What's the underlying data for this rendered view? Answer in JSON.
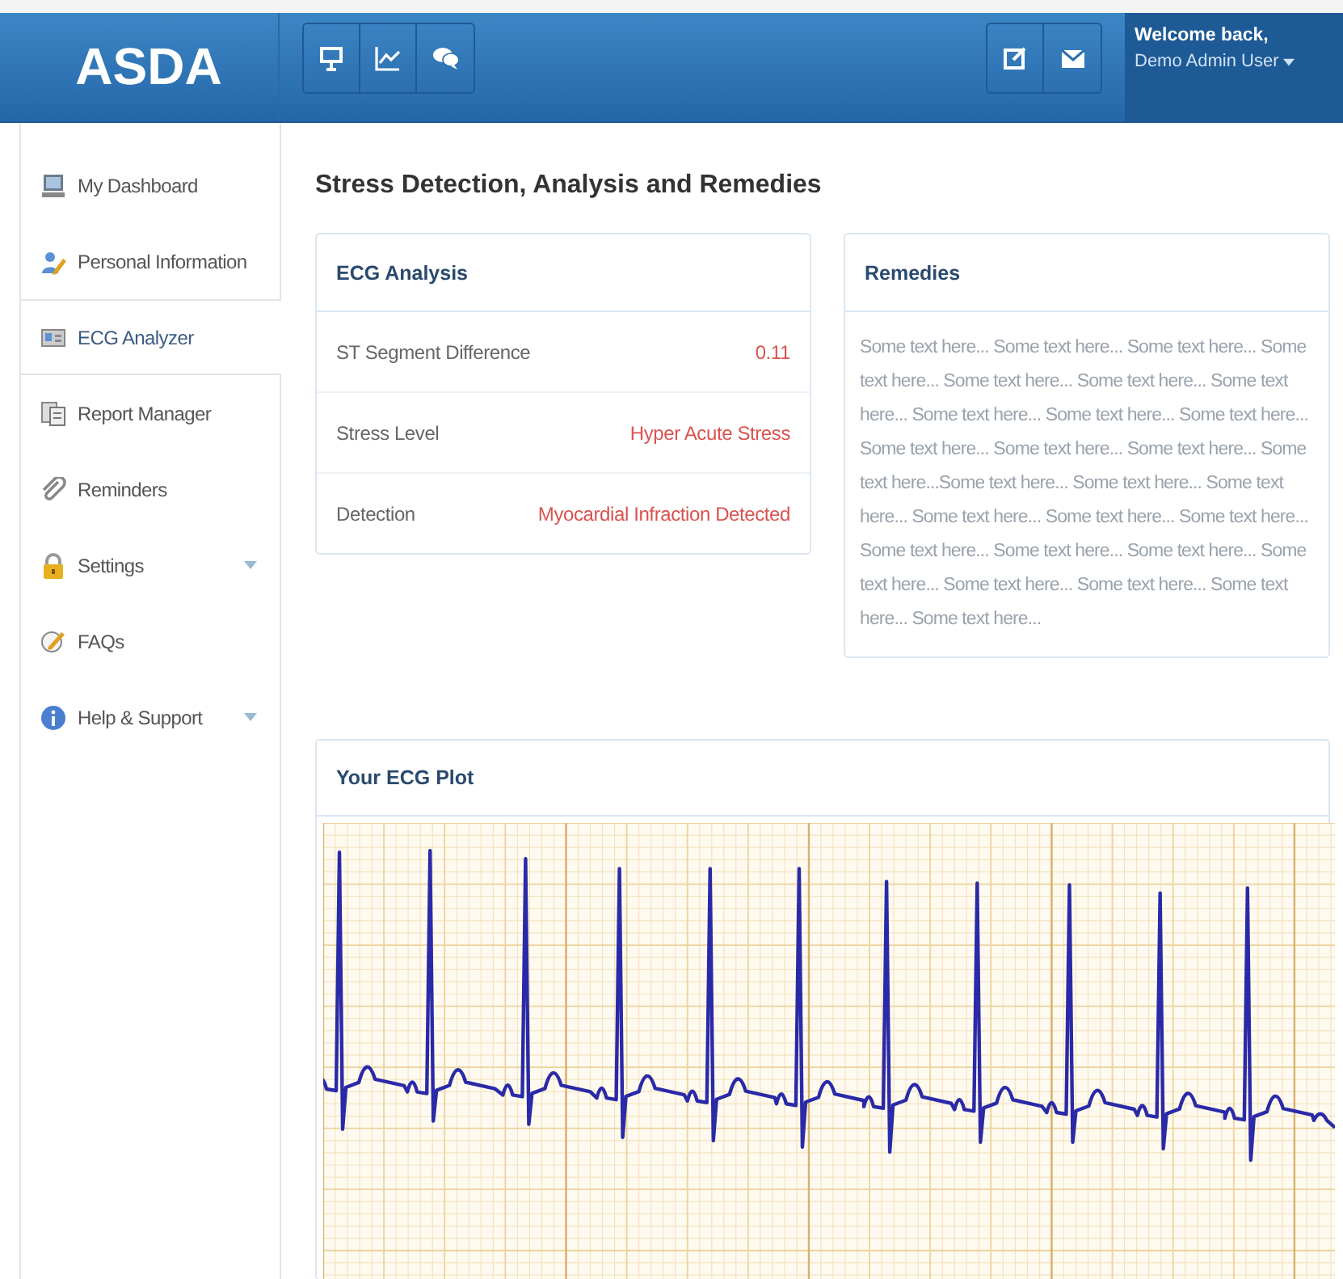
{
  "header": {
    "logo": "ASDA",
    "user": {
      "greeting": "Welcome back,",
      "name": "Demo Admin User"
    }
  },
  "sidebar": {
    "items": [
      {
        "label": "My Dashboard",
        "selected": false,
        "has_submenu": false
      },
      {
        "label": "Personal Information",
        "selected": false,
        "has_submenu": false
      },
      {
        "label": "ECG Analyzer",
        "selected": true,
        "has_submenu": false
      },
      {
        "label": "Report Manager",
        "selected": false,
        "has_submenu": false
      },
      {
        "label": "Reminders",
        "selected": false,
        "has_submenu": false
      },
      {
        "label": "Settings",
        "selected": false,
        "has_submenu": true
      },
      {
        "label": "FAQs",
        "selected": false,
        "has_submenu": false
      },
      {
        "label": "Help & Support",
        "selected": false,
        "has_submenu": true
      }
    ]
  },
  "page_title": "Stress Detection, Analysis and Remedies",
  "ecg_analysis": {
    "title": "ECG Analysis",
    "rows": [
      {
        "label": "ST Segment Difference",
        "value": "0.11"
      },
      {
        "label": "Stress Level",
        "value": "Hyper Acute Stress"
      },
      {
        "label": "Detection",
        "value": "Myocardial Infraction Detected"
      }
    ]
  },
  "remedies": {
    "title": "Remedies",
    "text": "Some text here... Some text here... Some text here... Some text here... Some text here... Some text here... Some text here... Some text here... Some text here... Some text here... Some text here... Some text here... Some text here... Some text here...Some text here... Some text here... Some text here... Some text here... Some text here... Some text here... Some text here... Some text here... Some text here... Some text here... Some text here... Some text here... Some text here... Some text here..."
  },
  "ecg_plot": {
    "title": "Your ECG Plot"
  }
}
